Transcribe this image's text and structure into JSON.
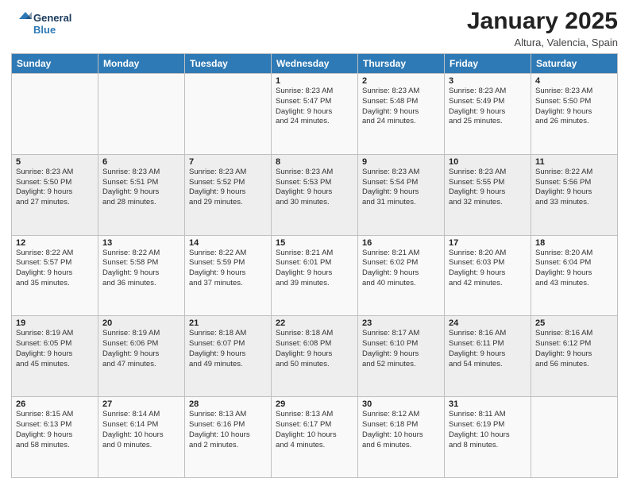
{
  "logo": {
    "line1": "General",
    "line2": "Blue"
  },
  "title": "January 2025",
  "subtitle": "Altura, Valencia, Spain",
  "headers": [
    "Sunday",
    "Monday",
    "Tuesday",
    "Wednesday",
    "Thursday",
    "Friday",
    "Saturday"
  ],
  "weeks": [
    [
      {
        "num": "",
        "info": ""
      },
      {
        "num": "",
        "info": ""
      },
      {
        "num": "",
        "info": ""
      },
      {
        "num": "1",
        "info": "Sunrise: 8:23 AM\nSunset: 5:47 PM\nDaylight: 9 hours\nand 24 minutes."
      },
      {
        "num": "2",
        "info": "Sunrise: 8:23 AM\nSunset: 5:48 PM\nDaylight: 9 hours\nand 24 minutes."
      },
      {
        "num": "3",
        "info": "Sunrise: 8:23 AM\nSunset: 5:49 PM\nDaylight: 9 hours\nand 25 minutes."
      },
      {
        "num": "4",
        "info": "Sunrise: 8:23 AM\nSunset: 5:50 PM\nDaylight: 9 hours\nand 26 minutes."
      }
    ],
    [
      {
        "num": "5",
        "info": "Sunrise: 8:23 AM\nSunset: 5:50 PM\nDaylight: 9 hours\nand 27 minutes."
      },
      {
        "num": "6",
        "info": "Sunrise: 8:23 AM\nSunset: 5:51 PM\nDaylight: 9 hours\nand 28 minutes."
      },
      {
        "num": "7",
        "info": "Sunrise: 8:23 AM\nSunset: 5:52 PM\nDaylight: 9 hours\nand 29 minutes."
      },
      {
        "num": "8",
        "info": "Sunrise: 8:23 AM\nSunset: 5:53 PM\nDaylight: 9 hours\nand 30 minutes."
      },
      {
        "num": "9",
        "info": "Sunrise: 8:23 AM\nSunset: 5:54 PM\nDaylight: 9 hours\nand 31 minutes."
      },
      {
        "num": "10",
        "info": "Sunrise: 8:23 AM\nSunset: 5:55 PM\nDaylight: 9 hours\nand 32 minutes."
      },
      {
        "num": "11",
        "info": "Sunrise: 8:22 AM\nSunset: 5:56 PM\nDaylight: 9 hours\nand 33 minutes."
      }
    ],
    [
      {
        "num": "12",
        "info": "Sunrise: 8:22 AM\nSunset: 5:57 PM\nDaylight: 9 hours\nand 35 minutes."
      },
      {
        "num": "13",
        "info": "Sunrise: 8:22 AM\nSunset: 5:58 PM\nDaylight: 9 hours\nand 36 minutes."
      },
      {
        "num": "14",
        "info": "Sunrise: 8:22 AM\nSunset: 5:59 PM\nDaylight: 9 hours\nand 37 minutes."
      },
      {
        "num": "15",
        "info": "Sunrise: 8:21 AM\nSunset: 6:01 PM\nDaylight: 9 hours\nand 39 minutes."
      },
      {
        "num": "16",
        "info": "Sunrise: 8:21 AM\nSunset: 6:02 PM\nDaylight: 9 hours\nand 40 minutes."
      },
      {
        "num": "17",
        "info": "Sunrise: 8:20 AM\nSunset: 6:03 PM\nDaylight: 9 hours\nand 42 minutes."
      },
      {
        "num": "18",
        "info": "Sunrise: 8:20 AM\nSunset: 6:04 PM\nDaylight: 9 hours\nand 43 minutes."
      }
    ],
    [
      {
        "num": "19",
        "info": "Sunrise: 8:19 AM\nSunset: 6:05 PM\nDaylight: 9 hours\nand 45 minutes."
      },
      {
        "num": "20",
        "info": "Sunrise: 8:19 AM\nSunset: 6:06 PM\nDaylight: 9 hours\nand 47 minutes."
      },
      {
        "num": "21",
        "info": "Sunrise: 8:18 AM\nSunset: 6:07 PM\nDaylight: 9 hours\nand 49 minutes."
      },
      {
        "num": "22",
        "info": "Sunrise: 8:18 AM\nSunset: 6:08 PM\nDaylight: 9 hours\nand 50 minutes."
      },
      {
        "num": "23",
        "info": "Sunrise: 8:17 AM\nSunset: 6:10 PM\nDaylight: 9 hours\nand 52 minutes."
      },
      {
        "num": "24",
        "info": "Sunrise: 8:16 AM\nSunset: 6:11 PM\nDaylight: 9 hours\nand 54 minutes."
      },
      {
        "num": "25",
        "info": "Sunrise: 8:16 AM\nSunset: 6:12 PM\nDaylight: 9 hours\nand 56 minutes."
      }
    ],
    [
      {
        "num": "26",
        "info": "Sunrise: 8:15 AM\nSunset: 6:13 PM\nDaylight: 9 hours\nand 58 minutes."
      },
      {
        "num": "27",
        "info": "Sunrise: 8:14 AM\nSunset: 6:14 PM\nDaylight: 10 hours\nand 0 minutes."
      },
      {
        "num": "28",
        "info": "Sunrise: 8:13 AM\nSunset: 6:16 PM\nDaylight: 10 hours\nand 2 minutes."
      },
      {
        "num": "29",
        "info": "Sunrise: 8:13 AM\nSunset: 6:17 PM\nDaylight: 10 hours\nand 4 minutes."
      },
      {
        "num": "30",
        "info": "Sunrise: 8:12 AM\nSunset: 6:18 PM\nDaylight: 10 hours\nand 6 minutes."
      },
      {
        "num": "31",
        "info": "Sunrise: 8:11 AM\nSunset: 6:19 PM\nDaylight: 10 hours\nand 8 minutes."
      },
      {
        "num": "",
        "info": ""
      }
    ]
  ]
}
